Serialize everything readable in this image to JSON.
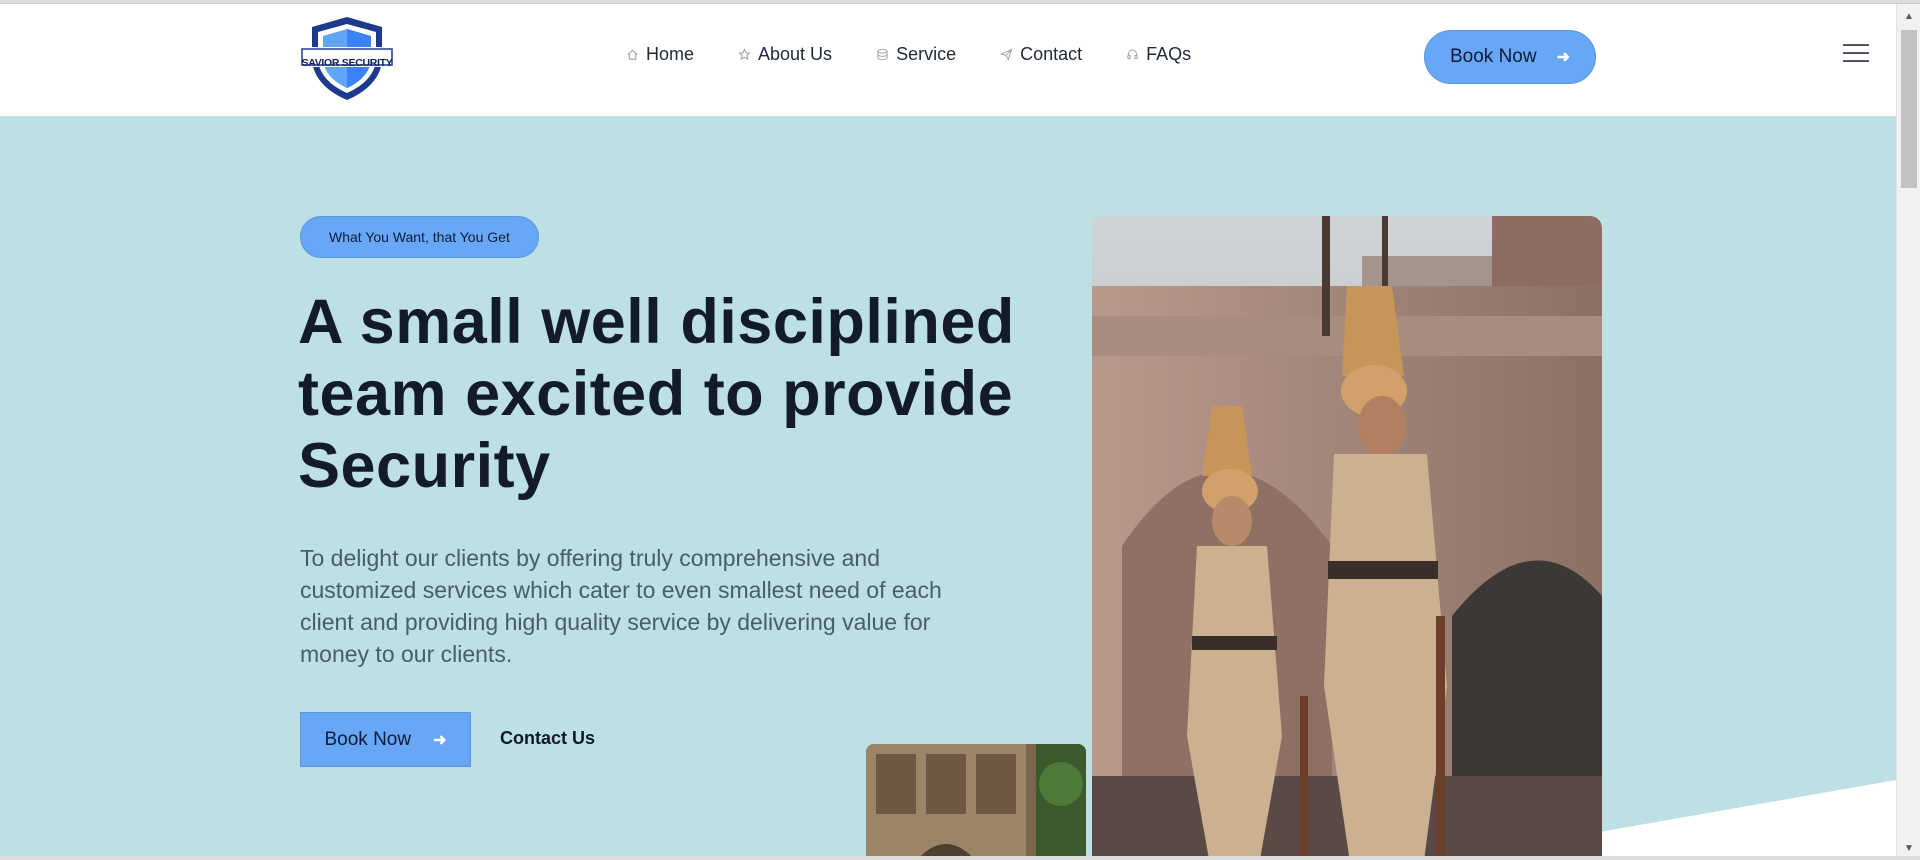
{
  "logo": {
    "text": "SAVIOR SECURITY",
    "colors": {
      "shield": "#1e3a8a",
      "shield_light": "#60a5fa"
    }
  },
  "nav": {
    "items": [
      {
        "label": "Home",
        "icon": "home-icon"
      },
      {
        "label": "About Us",
        "icon": "star-icon"
      },
      {
        "label": "Service",
        "icon": "database-icon"
      },
      {
        "label": "Contact",
        "icon": "send-icon"
      },
      {
        "label": "FAQs",
        "icon": "headset-icon"
      }
    ],
    "book_label": "Book Now",
    "book_icon": "arrow-right-icon",
    "menu_icon": "hamburger-menu-icon"
  },
  "hero": {
    "tagline": "What You Want, that You Get",
    "title_lines": [
      "A small well disciplined",
      "team excited to provide",
      "Security"
    ],
    "description": "To delight our clients by offering truly comprehensive and customized services which cater to even smallest need of each client and providing high quality service by delivering value for money to our clients.",
    "book_label": "Book Now",
    "contact_label": "Contact Us",
    "images": [
      "security-guards-photo",
      "palace-architecture-photo"
    ]
  },
  "colors": {
    "accent": "#67a7f5",
    "hero_bg": "#bde0e4",
    "title": "#121a2b",
    "body_text": "#4b5b6e"
  }
}
